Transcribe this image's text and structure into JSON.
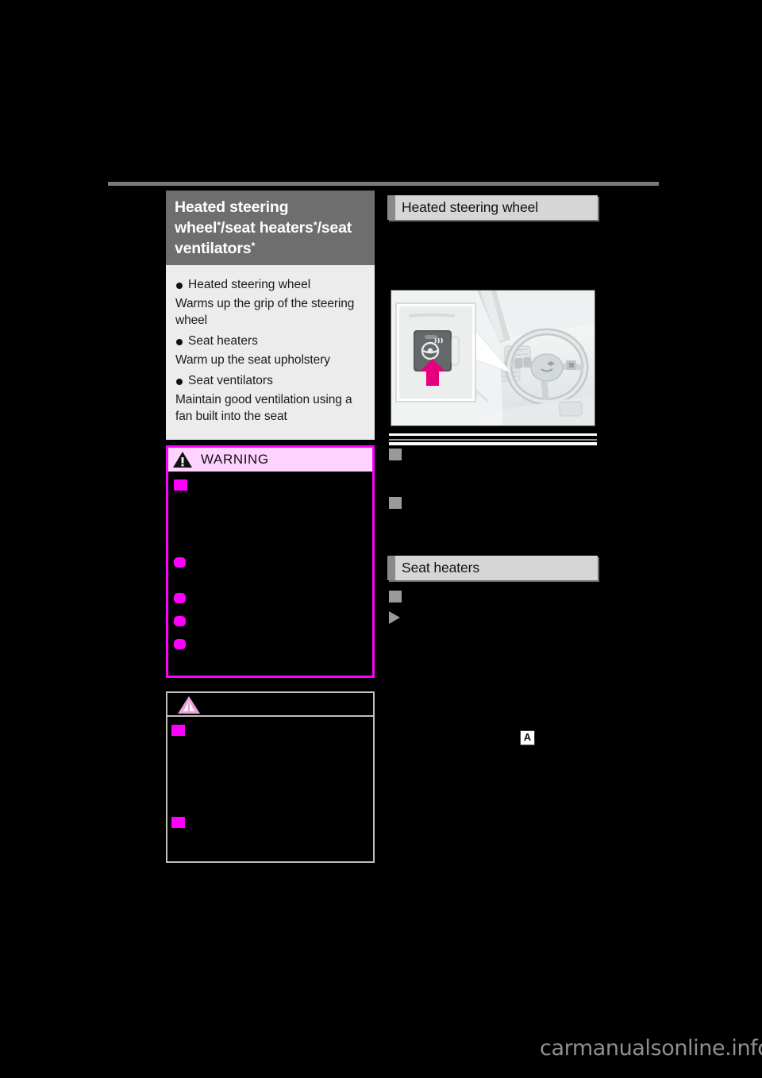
{
  "page": {
    "background_color": "#000000",
    "sheet_color": "#000000",
    "watermark": "carmanualsonline.info"
  },
  "left_column": {
    "main_title": {
      "line1_a": "Heated steering wheel",
      "line1_star": "*",
      "line1_b": "/seat",
      "line2_a": "heaters",
      "line2_star": "*",
      "line2_b": "/seat ventilators",
      "line2_star2": "*",
      "background_color": "#6e6e6e",
      "text_color": "#ffffff"
    },
    "description_box": {
      "background_color": "#ececec",
      "items": [
        {
          "bullet": "Heated steering wheel",
          "text": "Warms up the grip of the steering wheel"
        },
        {
          "bullet": "Seat heaters",
          "text": "Warm up the seat upholstery"
        },
        {
          "bullet": "Seat ventilators",
          "text": "Maintain good ventilation using a fan built into the seat"
        }
      ]
    },
    "warning_box": {
      "label": "WARNING",
      "icon": "warning-triangle-icon",
      "header_background": "#ffd2ff",
      "border_color": "#ff00ff",
      "body_background": "#000000",
      "bullet_color": "#ff00ff",
      "redacted": true
    },
    "notice_box": {
      "label": "",
      "icon": "notice-triangle-icon",
      "border_color": "#bfbfbf",
      "body_background": "#000000",
      "bullet_color": "#ff00ff",
      "redacted": true
    }
  },
  "right_column": {
    "sections": [
      {
        "title": "Heated steering wheel"
      },
      {
        "title": "Seat heaters"
      }
    ],
    "illustration": {
      "name": "steering-wheel-heater-button-illustration",
      "callout_arrow_color": "#e6007e",
      "button_icon": "heated-steering-wheel-icon",
      "brand_emblem": "lexus-emblem"
    },
    "marker_a": "A",
    "redacted": true
  }
}
